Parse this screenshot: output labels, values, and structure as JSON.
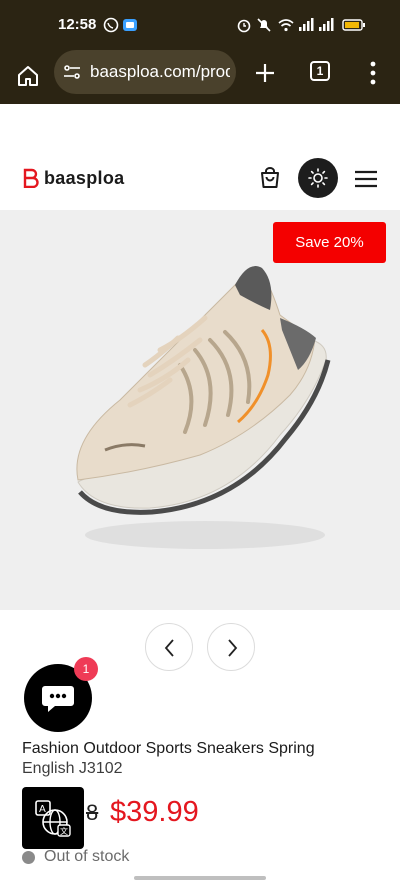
{
  "status_bar": {
    "time": "12:58",
    "icons": [
      "whatsapp-icon",
      "app-notification-icon",
      "alarm-icon",
      "mute-icon",
      "wifi-icon",
      "signal-icon",
      "signal-icon",
      "battery-icon"
    ]
  },
  "browser": {
    "url": "baasploa.com/prod",
    "tab_count": "1"
  },
  "header": {
    "logo_text": "baasploa",
    "brand_color": "#e4171f"
  },
  "product": {
    "save_badge": "Save 20%",
    "title": "Fashion Outdoor Sports Sneakers Spring",
    "title_overlap": "English J3102",
    "old_price": "8",
    "new_price": "$39.99",
    "stock": "Out of stock",
    "image": "beige-running-sneaker"
  },
  "chat": {
    "badge_count": "1"
  },
  "colors": {
    "top_bar": "#2b2413",
    "sale_red": "#f40000",
    "price_red": "#e4171f",
    "chat_badge": "#ef3b56"
  }
}
